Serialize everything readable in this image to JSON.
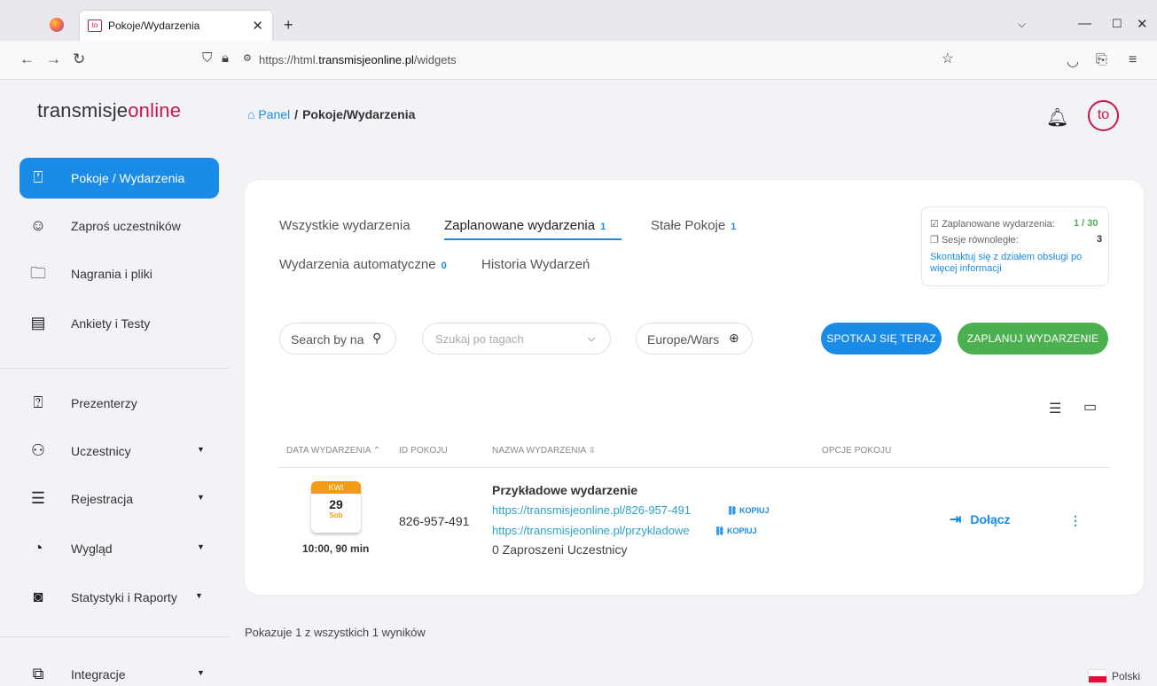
{
  "browser": {
    "tab_title": "Pokoje/Wydarzenia",
    "url_prefix": "https://html.",
    "url_domain": "transmisjeonline.pl",
    "url_path": "/widgets"
  },
  "sidebar": {
    "logo_main": "transmisje",
    "logo_accent": "online",
    "items": [
      {
        "label": "Pokoje / Wydarzenia"
      },
      {
        "label": "Zaproś uczestników"
      },
      {
        "label": "Nagrania i pliki"
      },
      {
        "label": "Ankiety i Testy"
      },
      {
        "label": "Prezenterzy"
      },
      {
        "label": "Uczestnicy"
      },
      {
        "label": "Rejestracja"
      },
      {
        "label": "Wygląd"
      },
      {
        "label": "Statystyki i Raporty"
      },
      {
        "label": "Integracje"
      }
    ]
  },
  "header": {
    "breadcrumb_home": "Panel",
    "breadcrumb_sep": "/",
    "breadcrumb_current": "Pokoje/Wydarzenia",
    "avatar_text": "to"
  },
  "tabs": [
    {
      "label": "Wszystkie wydarzenia",
      "count": ""
    },
    {
      "label": "Zaplanowane wydarzenia",
      "count": "1"
    },
    {
      "label": "Stałe Pokoje",
      "count": "1"
    },
    {
      "label": "Wydarzenia automatyczne",
      "count": "0"
    },
    {
      "label": "Historia Wydarzeń",
      "count": ""
    }
  ],
  "info": {
    "scheduled_label": "Zaplanowane wydarzenia:",
    "scheduled_value": "1 / 30",
    "sessions_label": "Sesje równoległe:",
    "sessions_value": "3",
    "contact_text": "Skontaktuj się z działem obsługi po więcej informacji"
  },
  "filters": {
    "search_placeholder": "Search by na",
    "tags_placeholder": "Szukaj po tagach",
    "timezone": "Europe/Wars"
  },
  "buttons": {
    "meet_now": "SPOTKAJ SIĘ TERAZ",
    "schedule": "ZAPLANUJ WYDARZENIE"
  },
  "table": {
    "headers": [
      "DATA WYDARZENIA",
      "ID POKOJU",
      "NAZWA WYDARZENIA",
      "OPCJE POKOJU"
    ],
    "rows": [
      {
        "month": "KWI",
        "day": "29",
        "weekday": "Sob",
        "time": "10:00, 90 min",
        "room_id": "826-957-491",
        "name": "Przykładowe wydarzenie",
        "link1": "https://transmisjeonline.pl/826-957-491",
        "link2": "https://transmisjeonline.pl/przykladowe",
        "copy_label": "KOPIUJ",
        "invited": "0 Zaproszeni Uczestnicy",
        "join_label": "Dołącz"
      }
    ]
  },
  "footer": {
    "results": "Pokazuje 1 z wszystkich 1 wyników",
    "language": "Polski"
  },
  "colors": {
    "accent_blue": "#1a8be6",
    "accent_green": "#4caf50",
    "brand_red": "#c8184a",
    "date_orange": "#f39c12"
  }
}
